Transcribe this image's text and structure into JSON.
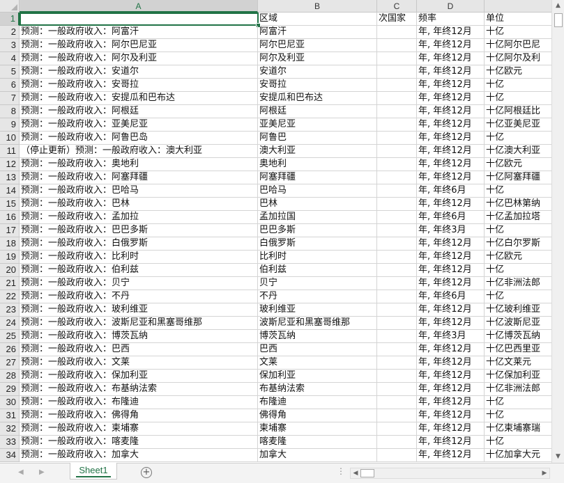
{
  "columns": [
    "A",
    "B",
    "C",
    "D"
  ],
  "active_cell": "A1",
  "headers": [
    "",
    "区域",
    "次国家",
    "频率",
    "单位"
  ],
  "rows": [
    [
      "2",
      "预测：一般政府收入：阿富汗",
      "阿富汗",
      "",
      "年, 年终12月",
      "十亿"
    ],
    [
      "3",
      "预测：一般政府收入：阿尔巴尼亚",
      "阿尔巴尼亚",
      "",
      "年, 年终12月",
      "十亿阿尔巴尼"
    ],
    [
      "4",
      "预测：一般政府收入：阿尔及利亚",
      "阿尔及利亚",
      "",
      "年, 年终12月",
      "十亿阿尔及利"
    ],
    [
      "5",
      "预测：一般政府收入：安道尔",
      "安道尔",
      "",
      "年, 年终12月",
      "十亿欧元"
    ],
    [
      "6",
      "预测：一般政府收入：安哥拉",
      "安哥拉",
      "",
      "年, 年终12月",
      "十亿"
    ],
    [
      "7",
      "预测：一般政府收入：安提瓜和巴布达",
      "安提瓜和巴布达",
      "",
      "年, 年终12月",
      "十亿"
    ],
    [
      "8",
      "预测：一般政府收入：阿根廷",
      "阿根廷",
      "",
      "年, 年终12月",
      "十亿阿根廷比"
    ],
    [
      "9",
      "预测：一般政府收入：亚美尼亚",
      "亚美尼亚",
      "",
      "年, 年终12月",
      "十亿亚美尼亚"
    ],
    [
      "10",
      "预测：一般政府收入：阿鲁巴岛",
      "阿鲁巴",
      "",
      "年, 年终12月",
      "十亿"
    ],
    [
      "11",
      "（停止更新）预测：一般政府收入：澳大利亚",
      "澳大利亚",
      "",
      "年, 年终12月",
      "十亿澳大利亚"
    ],
    [
      "12",
      "预测：一般政府收入：奥地利",
      "奥地利",
      "",
      "年, 年终12月",
      "十亿欧元"
    ],
    [
      "13",
      "预测：一般政府收入：阿塞拜疆",
      "阿塞拜疆",
      "",
      "年, 年终12月",
      "十亿阿塞拜疆"
    ],
    [
      "14",
      "预测：一般政府收入：巴哈马",
      "巴哈马",
      "",
      "年, 年终6月",
      "十亿"
    ],
    [
      "15",
      "预测：一般政府收入：巴林",
      "巴林",
      "",
      "年, 年终12月",
      "十亿巴林第纳"
    ],
    [
      "16",
      "预测：一般政府收入：孟加拉",
      "孟加拉国",
      "",
      "年, 年终6月",
      "十亿孟加拉塔"
    ],
    [
      "17",
      "预测：一般政府收入：巴巴多斯",
      "巴巴多斯",
      "",
      "年, 年终3月",
      "十亿"
    ],
    [
      "18",
      "预测：一般政府收入：白俄罗斯",
      "白俄罗斯",
      "",
      "年, 年终12月",
      "十亿白尔罗斯"
    ],
    [
      "19",
      "预测：一般政府收入：比利时",
      "比利时",
      "",
      "年, 年终12月",
      "十亿欧元"
    ],
    [
      "20",
      "预测：一般政府收入：伯利兹",
      "伯利兹",
      "",
      "年, 年终12月",
      "十亿"
    ],
    [
      "21",
      "预测：一般政府收入：贝宁",
      "贝宁",
      "",
      "年, 年终12月",
      "十亿非洲法郎"
    ],
    [
      "22",
      "预测：一般政府收入：不丹",
      "不丹",
      "",
      "年, 年终6月",
      "十亿"
    ],
    [
      "23",
      "预测：一般政府收入：玻利维亚",
      "玻利维亚",
      "",
      "年, 年终12月",
      "十亿玻利维亚"
    ],
    [
      "24",
      "预测：一般政府收入：波斯尼亚和黑塞哥维那",
      "波斯尼亚和黑塞哥维那",
      "",
      "年, 年终12月",
      "十亿波斯尼亚"
    ],
    [
      "25",
      "预测：一般政府收入：博茨瓦纳",
      "博茨瓦纳",
      "",
      "年, 年终3月",
      "十亿博茨瓦纳"
    ],
    [
      "26",
      "预测：一般政府收入：巴西",
      "巴西",
      "",
      "年, 年终12月",
      "十亿巴西里亚"
    ],
    [
      "27",
      "预测：一般政府收入：文莱",
      "文莱",
      "",
      "年, 年终12月",
      "十亿文莱元"
    ],
    [
      "28",
      "预测：一般政府收入：保加利亚",
      "保加利亚",
      "",
      "年, 年终12月",
      "十亿保加利亚"
    ],
    [
      "29",
      "预测：一般政府收入：布基纳法索",
      "布基纳法索",
      "",
      "年, 年终12月",
      "十亿非洲法郎"
    ],
    [
      "30",
      "预测：一般政府收入：布隆迪",
      "布隆迪",
      "",
      "年, 年终12月",
      "十亿"
    ],
    [
      "31",
      "预测：一般政府收入：佛得角",
      "佛得角",
      "",
      "年, 年终12月",
      "十亿"
    ],
    [
      "32",
      "预测：一般政府收入：柬埔寨",
      "柬埔寨",
      "",
      "年, 年终12月",
      "十亿柬埔寨瑞"
    ],
    [
      "33",
      "预测：一般政府收入：喀麦隆",
      "喀麦隆",
      "",
      "年, 年终12月",
      "十亿"
    ],
    [
      "34",
      "预测：一般政府收入：加拿大",
      "加拿大",
      "",
      "年, 年终12月",
      "十亿加拿大元"
    ]
  ],
  "sheet_tabs": [
    "Sheet1"
  ],
  "add_sheet_label": "+",
  "tab_dots": "⋮"
}
